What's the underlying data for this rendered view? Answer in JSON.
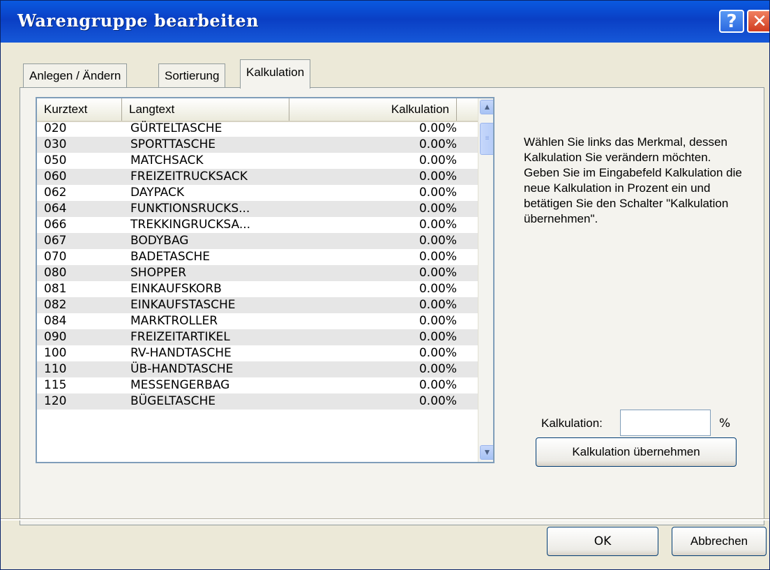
{
  "window": {
    "title": "Warengruppe bearbeiten"
  },
  "title_buttons": {
    "help": "?",
    "close": "✕"
  },
  "tabs": [
    {
      "label": "Anlegen / Ändern"
    },
    {
      "label": "Sortierung"
    },
    {
      "label": "Kalkulation"
    }
  ],
  "table": {
    "columns": [
      "Kurztext",
      "Langtext",
      "Kalkulation"
    ],
    "rows": [
      [
        "020",
        "GÜRTELTASCHE",
        "0.00%"
      ],
      [
        "030",
        "SPORTTASCHE",
        "0.00%"
      ],
      [
        "050",
        "MATCHSACK",
        "0.00%"
      ],
      [
        "060",
        "FREIZEITRUCKSACK",
        "0.00%"
      ],
      [
        "062",
        "DAYPACK",
        "0.00%"
      ],
      [
        "064",
        "FUNKTIONSRUCKS...",
        "0.00%"
      ],
      [
        "066",
        "TREKKINGRUCKSA...",
        "0.00%"
      ],
      [
        "067",
        "BODYBAG",
        "0.00%"
      ],
      [
        "070",
        "BADETASCHE",
        "0.00%"
      ],
      [
        "080",
        "SHOPPER",
        "0.00%"
      ],
      [
        "081",
        "EINKAUFSKORB",
        "0.00%"
      ],
      [
        "082",
        "EINKAUFSTASCHE",
        "0.00%"
      ],
      [
        "084",
        "MARKTROLLER",
        "0.00%"
      ],
      [
        "090",
        "FREIZEITARTIKEL",
        "0.00%"
      ],
      [
        "100",
        "RV-HANDTASCHE",
        "0.00%"
      ],
      [
        "110",
        "ÜB-HANDTASCHE",
        "0.00%"
      ],
      [
        "115",
        "MESSENGERBAG",
        "0.00%"
      ],
      [
        "120",
        "BÜGELTASCHE",
        "0.00%"
      ]
    ]
  },
  "scrollbar": {
    "up": "▲",
    "down": "▼",
    "grip": "≡"
  },
  "help_text": "Wählen Sie links das Merkmal, dessen Kalkulation Sie verändern möchten. Geben Sie im Eingabefeld Kalkulation die neue Kalkulation in Prozent ein und betätigen Sie den Schalter \"Kalkulation übernehmen\".",
  "kalkulation_field": {
    "label": "Kalkulation:",
    "value": "",
    "unit": "%"
  },
  "buttons": {
    "apply": "Kalkulation übernehmen",
    "ok": "OK",
    "cancel": "Abbrechen"
  }
}
